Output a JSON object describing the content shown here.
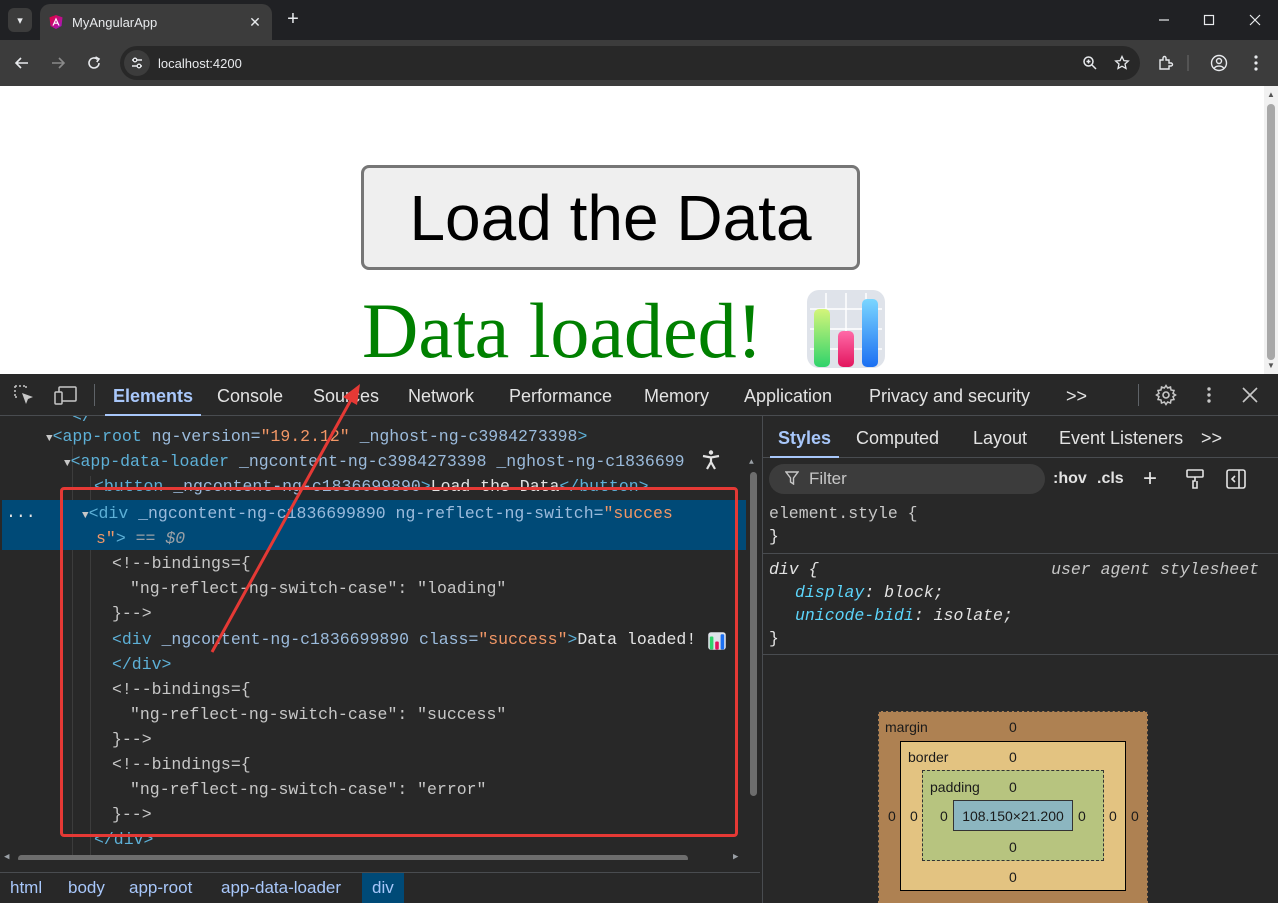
{
  "browser": {
    "tab_title": "MyAngularApp",
    "new_tab_symbol": "+",
    "url": "localhost:4200"
  },
  "page": {
    "button_label": "Load the Data",
    "success_message": "Data loaded!"
  },
  "devtools": {
    "tabs": [
      "Elements",
      "Console",
      "Sources",
      "Network",
      "Performance",
      "Memory",
      "Application",
      "Privacy and security"
    ],
    "more_tabs": ">>",
    "dom": {
      "line1_tag": "<app-root",
      "line1_attr": " ng-version=",
      "line1_val": "\"19.2.12\"",
      "line1_attr2": " _nghost-ng-c3984273398",
      "line1_end": ">",
      "line2_tag": "<app-data-loader",
      "line2_attr": " _ngcontent-ng-c3984273398 _nghost-ng-c1836699",
      "line3_open": "<button",
      "line3_attr": " _ngcontent-ng-c1836699890",
      "line3_text": "Load the Data",
      "line3_close": "</button>",
      "line4_tag": "<div",
      "line4_attr": " _ngcontent-ng-c1836699890 ng-reflect-ng-switch=",
      "line4_val": "\"succes",
      "line5_val": "s\"",
      "line5_end": ">",
      "line5_eq": " == $0",
      "cm1_a": "<!--bindings={",
      "cm1_b": "\"ng-reflect-ng-switch-case\": \"loading\"",
      "cm1_c": "}-->",
      "inner_tag": "<div",
      "inner_attr": " _ngcontent-ng-c1836699890 class=",
      "inner_val": "\"success\"",
      "inner_end": ">",
      "inner_text": "Data loaded! ",
      "inner_close": "</div>",
      "cm2_a": "<!--bindings={",
      "cm2_b": "\"ng-reflect-ng-switch-case\": \"success\"",
      "cm2_c": "}-->",
      "cm3_a": "<!--bindings={",
      "cm3_b": "\"ng-reflect-ng-switch-case\": \"error\"",
      "cm3_c": "}-->",
      "outer_close": "</div>",
      "dots": "..."
    },
    "breadcrumbs": [
      "html",
      "body",
      "app-root",
      "app-data-loader",
      "div"
    ],
    "styles_tabs": [
      "Styles",
      "Computed",
      "Layout",
      "Event Listeners"
    ],
    "styles_more": ">>",
    "filter_placeholder": "Filter",
    "hov": ":hov",
    "cls": ".cls",
    "rules": {
      "element_style": "element.style {",
      "element_close": "}",
      "div_selector": "div {",
      "div_origin": "user agent stylesheet",
      "p1_name": "display",
      "p1_value": "block;",
      "p2_name": "unicode-bidi",
      "p2_value": "isolate;",
      "div_close": "}"
    },
    "box_model": {
      "margin_label": "margin",
      "border_label": "border",
      "padding_label": "padding",
      "content_size": "108.150×21.200",
      "zero": "0"
    }
  },
  "colors": {
    "success_green": "#008000",
    "selected_row": "#004a77",
    "annotation_red": "#e53935"
  }
}
